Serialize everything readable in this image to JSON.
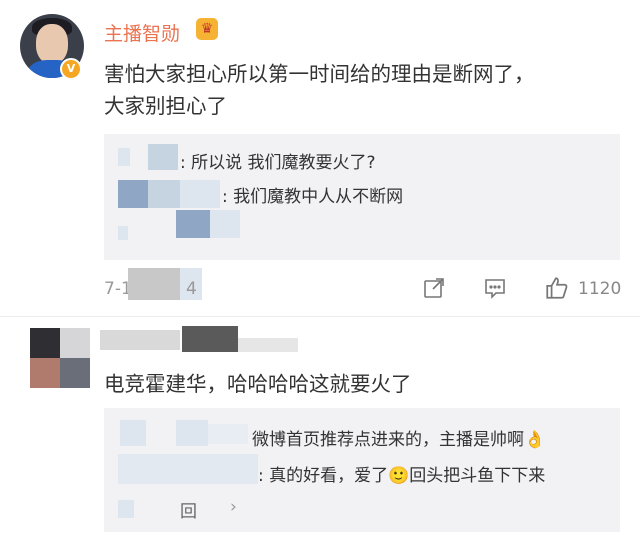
{
  "comment1": {
    "username": "主播智勋",
    "verified_badge": "V",
    "crown_icon": "crown-badge",
    "text_line1": "害怕大家担心所以第一时间给的理由是断网了，",
    "text_line2": "大家别担心了",
    "replies": [
      {
        "text": ": 所以说 我们魔教要火了?"
      },
      {
        "text": ": 我们魔教中人从不断网"
      }
    ],
    "timestamp_visible_start": "7-1",
    "timestamp_visible_end": "4",
    "likes": "1120"
  },
  "comment2": {
    "text": "电竞霍建华，哈哈哈哈这就要火了",
    "replies": [
      {
        "text": "微博首页推荐点进来的，主播是帅啊👌"
      },
      {
        "text": ": 真的好看，爱了🙂回头把斗鱼下下来"
      }
    ],
    "reply_footer_fragment": "回"
  },
  "icons": {
    "share": "share-icon",
    "comment": "comment-icon",
    "like": "thumbs-up-icon"
  }
}
